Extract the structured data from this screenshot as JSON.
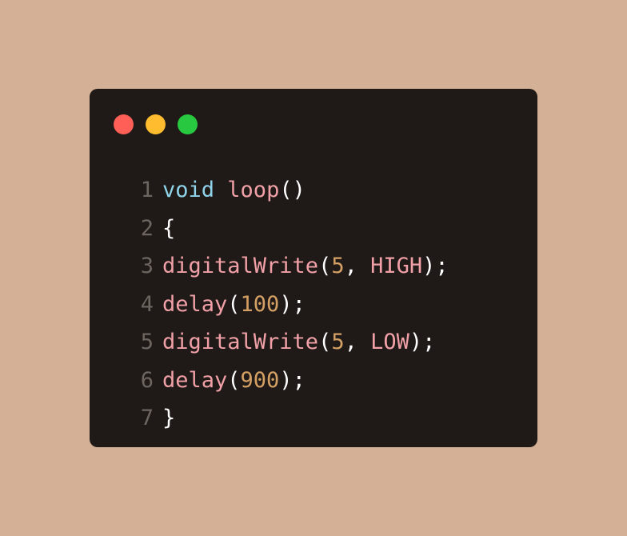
{
  "window": {
    "traffic_lights": [
      {
        "name": "close",
        "color": "#ff5f57"
      },
      {
        "name": "minimize",
        "color": "#febc2e"
      },
      {
        "name": "zoom",
        "color": "#28c840"
      }
    ]
  },
  "colors": {
    "background": "#d3b096",
    "editor_background": "#1f1a17",
    "line_number": "#6d655f",
    "keyword": "#8fd3ec",
    "function": "#f0a0a6",
    "number": "#d4a064",
    "punctuation": "#ffffff"
  },
  "code": {
    "lines": [
      {
        "number": "1",
        "tokens": [
          {
            "text": "void",
            "type": "kw"
          },
          {
            "text": " ",
            "type": "punc"
          },
          {
            "text": "loop",
            "type": "fn"
          },
          {
            "text": "()",
            "type": "punc"
          }
        ]
      },
      {
        "number": "2",
        "tokens": [
          {
            "text": "{",
            "type": "punc"
          }
        ]
      },
      {
        "number": "3",
        "tokens": [
          {
            "text": "digitalWrite",
            "type": "fn"
          },
          {
            "text": "(",
            "type": "punc"
          },
          {
            "text": "5",
            "type": "num"
          },
          {
            "text": ", ",
            "type": "punc"
          },
          {
            "text": "HIGH",
            "type": "fn"
          },
          {
            "text": ");",
            "type": "punc"
          }
        ]
      },
      {
        "number": "4",
        "tokens": [
          {
            "text": "delay",
            "type": "fn"
          },
          {
            "text": "(",
            "type": "punc"
          },
          {
            "text": "100",
            "type": "num"
          },
          {
            "text": ");",
            "type": "punc"
          }
        ]
      },
      {
        "number": "5",
        "tokens": [
          {
            "text": "digitalWrite",
            "type": "fn"
          },
          {
            "text": "(",
            "type": "punc"
          },
          {
            "text": "5",
            "type": "num"
          },
          {
            "text": ", ",
            "type": "punc"
          },
          {
            "text": "LOW",
            "type": "fn"
          },
          {
            "text": ");",
            "type": "punc"
          }
        ]
      },
      {
        "number": "6",
        "tokens": [
          {
            "text": "delay",
            "type": "fn"
          },
          {
            "text": "(",
            "type": "punc"
          },
          {
            "text": "900",
            "type": "num"
          },
          {
            "text": ");",
            "type": "punc"
          }
        ]
      },
      {
        "number": "7",
        "tokens": [
          {
            "text": "}",
            "type": "punc"
          }
        ]
      }
    ]
  }
}
